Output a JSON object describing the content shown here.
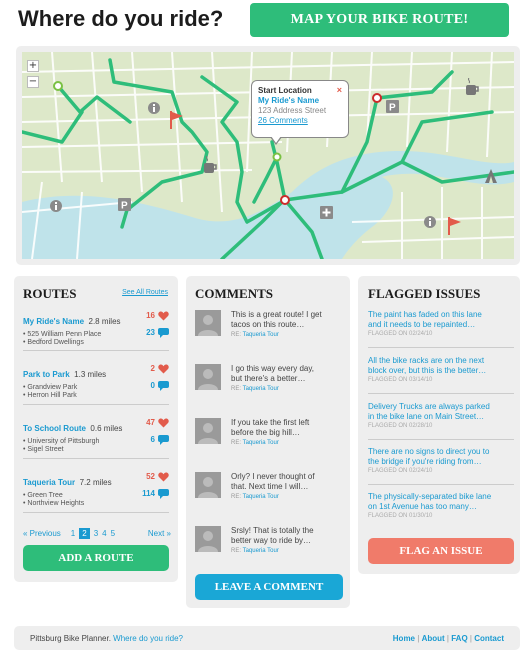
{
  "header": {
    "title": "Where do you ride?",
    "map_button": "MAP YOUR BIKE ROUTE!"
  },
  "map": {
    "zoom_in": "+",
    "zoom_out": "−",
    "popup": {
      "title": "Start Location",
      "route_name": "My Ride's Name",
      "address": "123 Address Street",
      "comments_link": "26 Comments",
      "close": "×"
    },
    "markers": [
      "info-icon",
      "parking-icon",
      "flag-icon",
      "coffee-icon",
      "campsite-icon",
      "first-aid-icon"
    ]
  },
  "routes": {
    "title": "ROUTES",
    "see_all": "See All Routes",
    "items": [
      {
        "name": "My Ride's Name",
        "distance": "2.8 miles",
        "stop1": "• 525 William Penn Place",
        "stop2": "• Bedford Dwellings",
        "likes": "16",
        "comments": "23"
      },
      {
        "name": "Park to Park",
        "distance": "1.3 miles",
        "stop1": "• Grandview Park",
        "stop2": "• Herron Hill Park",
        "likes": "2",
        "comments": "0"
      },
      {
        "name": "To School Route",
        "distance": "0.6 miles",
        "stop1": "• University of Pittsburgh",
        "stop2": "• Sigel Street",
        "likes": "47",
        "comments": "6"
      },
      {
        "name": "Taqueria Tour",
        "distance": "7.2 miles",
        "stop1": "• Green Tree",
        "stop2": "• Northview Heights",
        "likes": "52",
        "comments": "114"
      }
    ],
    "pager": {
      "prev": "« Previous",
      "pages": [
        "1",
        "2",
        "3",
        "4",
        "5"
      ],
      "current": "2",
      "next": "Next »"
    },
    "add_button": "ADD A ROUTE"
  },
  "comments": {
    "title": "COMMENTS",
    "re_prefix": "RE:",
    "items": [
      {
        "line1": "This is a great route! I get",
        "line2": "tacos on this route…",
        "re": "Taqueria Tour"
      },
      {
        "line1": "I go this way every day,",
        "line2": "but there's a better…",
        "re": "Taqueria Tour"
      },
      {
        "line1": "If you take the first left",
        "line2": "before the big hill…",
        "re": "Taqueria Tour"
      },
      {
        "line1": "Orly? I never thought of",
        "line2": "that. Next time I will…",
        "re": "Taqueria Tour"
      },
      {
        "line1": "Srsly! That is totally the",
        "line2": "better way to ride by…",
        "re": "Taqueria Tour"
      }
    ],
    "leave_button": "LEAVE A COMMENT"
  },
  "issues": {
    "title": "FLAGGED ISSUES",
    "items": [
      {
        "line1": "The paint has faded on this lane",
        "line2": "and it needs to be repainted…",
        "date": "FLAGGED ON 02/24/10"
      },
      {
        "line1": "All the bike racks are on the next",
        "line2": "block over, but this is the better…",
        "date": "FLAGGED ON 03/14/10"
      },
      {
        "line1": "Delivery Trucks are always parked",
        "line2": "in the bike lane on Main Street…",
        "date": "FLAGGED ON 02/28/10"
      },
      {
        "line1": "There are no signs to direct you to",
        "line2": "the bridge if you're riding from…",
        "date": "FLAGGED ON 02/24/10"
      },
      {
        "line1": "The physically-separated bike lane",
        "line2": "on 1st Avenue has too many…",
        "date": "FLAGGED ON 01/30/10"
      }
    ],
    "flag_button": "FLAG AN ISSUE"
  },
  "footer": {
    "text": "Pittsburg Bike Planner.",
    "tagline": "Where do you ride?",
    "links": [
      "Home",
      "About",
      "FAQ",
      "Contact"
    ],
    "separator": "|"
  },
  "colors": {
    "green": "#2ebd7a",
    "blue": "#1a9ad0",
    "red": "#e25b4b",
    "coral": "#f07b6a",
    "panel": "#eeeeee"
  }
}
